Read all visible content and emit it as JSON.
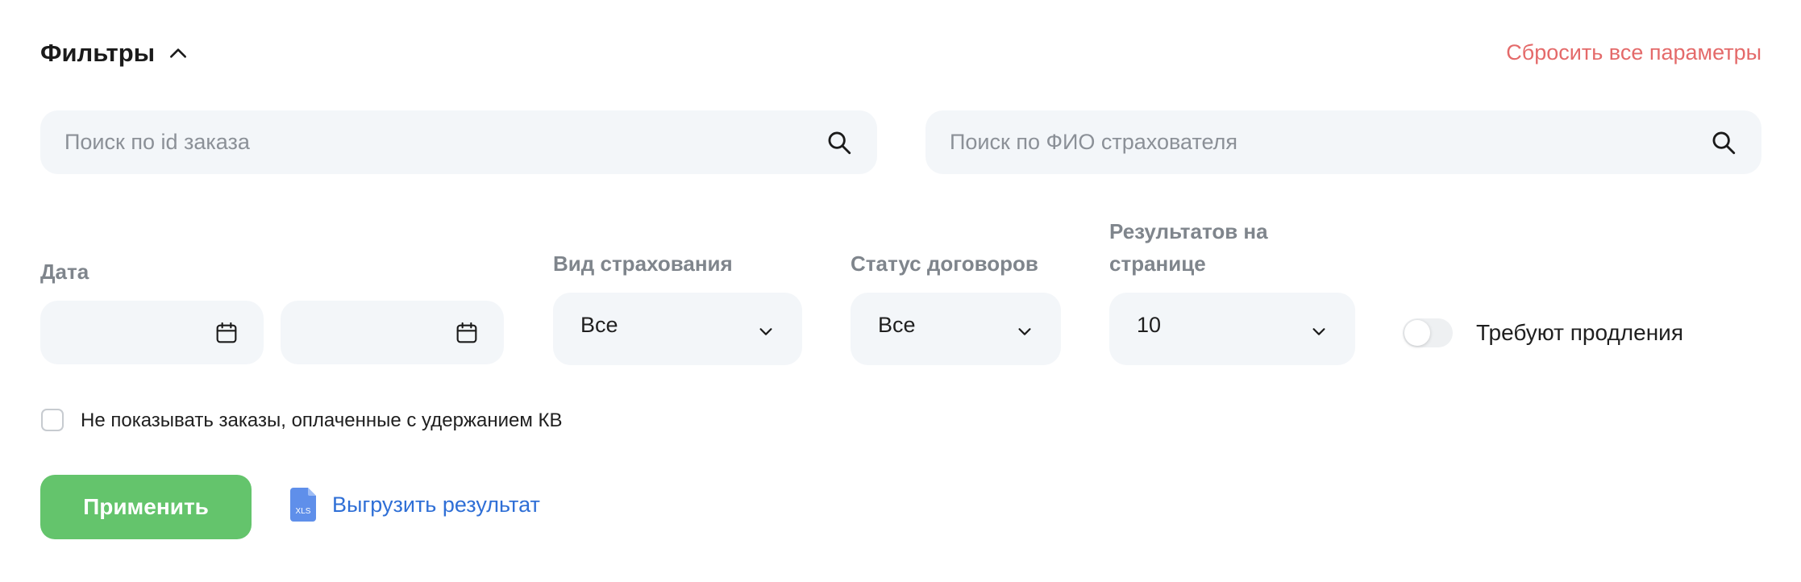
{
  "header": {
    "title": "Фильтры",
    "reset_label": "Сбросить все параметры"
  },
  "search": {
    "order_id_placeholder": "Поиск по id заказа",
    "order_id_value": "",
    "insurer_name_placeholder": "Поиск по ФИО страхователя",
    "insurer_name_value": ""
  },
  "filters": {
    "date_label": "Дата",
    "date_from": "",
    "date_to": "",
    "insurance_type_label": "Вид страхования",
    "insurance_type_value": "Все",
    "contract_status_label": "Статус договоров",
    "contract_status_value": "Все",
    "per_page_label_line1": "Результатов на",
    "per_page_label_line2": "странице",
    "per_page_value": "10",
    "renewal_toggle_label": "Требуют продления",
    "renewal_toggle_on": false,
    "hide_kv_label": "Не показывать заказы, оплаченные с удержанием КВ",
    "hide_kv_checked": false
  },
  "actions": {
    "apply_label": "Применить",
    "export_label": "Выгрузить результат",
    "export_icon_text": "XLS"
  },
  "colors": {
    "accent_green": "#64c46c",
    "link_blue": "#2f6fd6",
    "reset_red": "#e46a6a",
    "field_bg": "#f3f6f9",
    "xls_icon": "#5f8fea"
  },
  "icons": [
    "chevron-up-icon",
    "search-icon",
    "calendar-icon",
    "chevron-down-icon",
    "xls-file-icon"
  ]
}
